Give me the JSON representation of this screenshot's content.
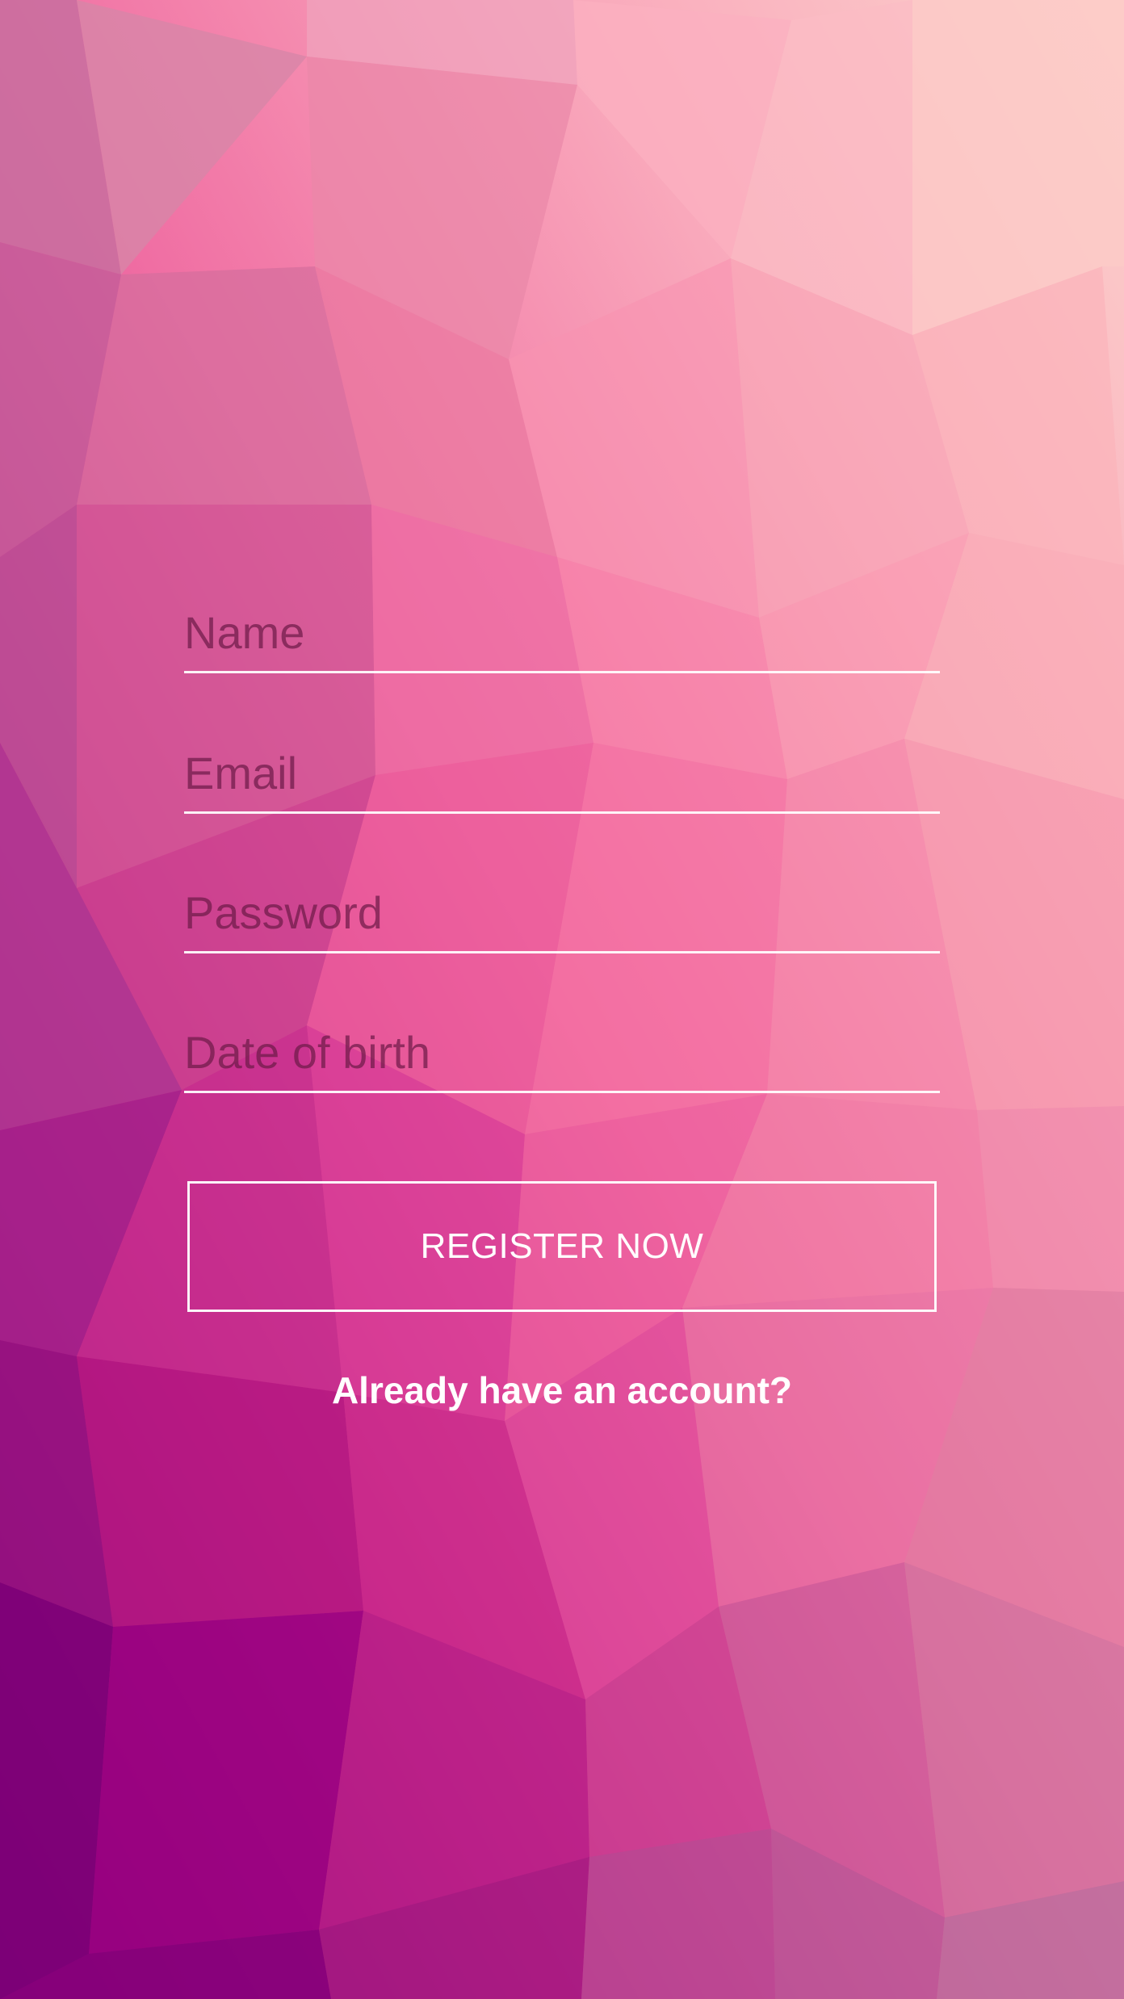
{
  "form": {
    "fields": [
      {
        "name": "name",
        "value": "",
        "placeholder": "Name"
      },
      {
        "name": "email",
        "value": "",
        "placeholder": "Email"
      },
      {
        "name": "password",
        "value": "",
        "placeholder": "Password"
      },
      {
        "name": "dob",
        "value": "",
        "placeholder": "Date of birth"
      }
    ],
    "register_label": "REGISTER NOW",
    "login_link": "Already have an account?"
  },
  "theme": {
    "background": "low-poly pink-to-purple gradient",
    "accent": "#ffffff",
    "placeholder_color": "#7a2456"
  }
}
